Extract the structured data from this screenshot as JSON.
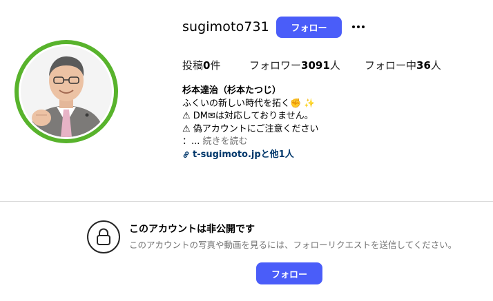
{
  "profile": {
    "username": "sugimoto731",
    "follow_label": "フォロー",
    "more_options": "more-options-icon"
  },
  "stats": {
    "posts_label": "投稿",
    "posts_count": "0",
    "posts_unit": "件",
    "followers_label": "フォロワー",
    "followers_count": "3091",
    "followers_unit": "人",
    "following_label": "フォロー中",
    "following_count": "36",
    "following_unit": "人"
  },
  "bio": {
    "name": "杉本達治（杉本たつじ）",
    "line1": "ふくいの新しい時代を拓く✊ ✨",
    "line2": "⚠ DM✉は対応しておりません。",
    "line3": "⚠ 偽アカウントにご注意ください",
    "line4_prefix": "：...",
    "more_link": "続きを読む",
    "url": "t-sugimoto.jpと他1人"
  },
  "private": {
    "title": "このアカウントは非公開です",
    "description": "このアカウントの写真や動画を見るには、フォローリクエストを送信してください。",
    "follow_label": "フォロー",
    "icon": "lock-icon"
  },
  "colors": {
    "accent": "#4a5df9",
    "avatar_ring": "#58b32c",
    "link": "#00376b",
    "muted": "#737373"
  }
}
